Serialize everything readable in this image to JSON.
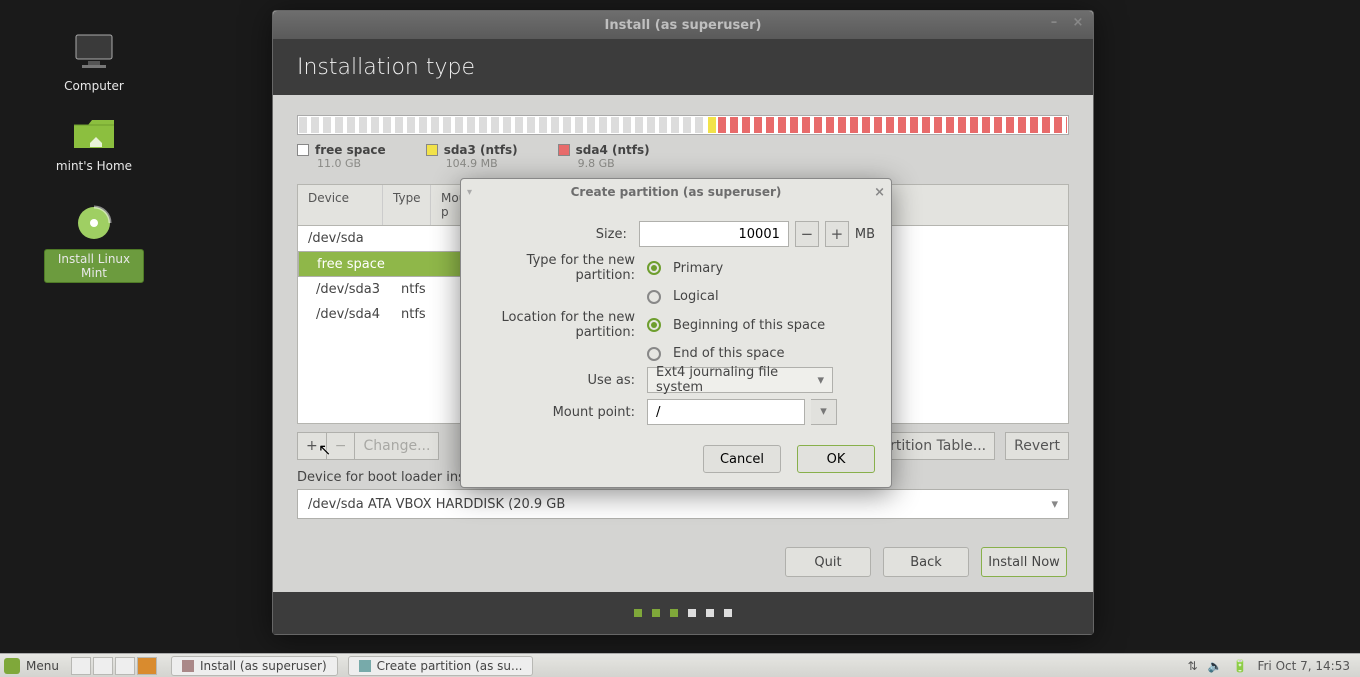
{
  "desktop": {
    "computer": "Computer",
    "home": "mint's Home",
    "install": "Install Linux Mint"
  },
  "installer": {
    "window_title": "Install (as superuser)",
    "header": "Installation type",
    "legend": [
      {
        "label": "free space",
        "size": "11.0 GB",
        "color": "#ffffff"
      },
      {
        "label": "sda3 (ntfs)",
        "size": "104.9 MB",
        "color": "#f2e24a"
      },
      {
        "label": "sda4 (ntfs)",
        "size": "9.8 GB",
        "color": "#e86b6b"
      }
    ],
    "columns": {
      "device": "Device",
      "type": "Type",
      "mount": "Mount p"
    },
    "rows": [
      {
        "device": "/dev/sda",
        "type": "",
        "header": true
      },
      {
        "device": "free space",
        "type": "",
        "selected": true
      },
      {
        "device": "/dev/sda3",
        "type": "ntfs"
      },
      {
        "device": "/dev/sda4",
        "type": "ntfs"
      }
    ],
    "tools": {
      "add": "+",
      "remove": "−",
      "change": "Change...",
      "new_table": "…rtition Table...",
      "revert": "Revert"
    },
    "bootloader_label": "Device for boot loader installa",
    "bootloader_value": "/dev/sda   ATA VBOX HARDDISK (20.9 GB",
    "nav": {
      "quit": "Quit",
      "back": "Back",
      "install": "Install Now"
    }
  },
  "dialog": {
    "title": "Create partition (as superuser)",
    "size_label": "Size:",
    "size_value": "10001",
    "size_unit": "MB",
    "type_label": "Type for the new partition:",
    "type_primary": "Primary",
    "type_logical": "Logical",
    "loc_label": "Location for the new partition:",
    "loc_begin": "Beginning of this space",
    "loc_end": "End of this space",
    "use_as_label": "Use as:",
    "use_as_value": "Ext4 journaling file system",
    "mount_label": "Mount point:",
    "mount_value": "/",
    "cancel": "Cancel",
    "ok": "OK"
  },
  "taskbar": {
    "menu": "Menu",
    "task1": "Install (as superuser)",
    "task2": "Create partition (as su...",
    "clock": "Fri Oct  7, 14:53"
  }
}
